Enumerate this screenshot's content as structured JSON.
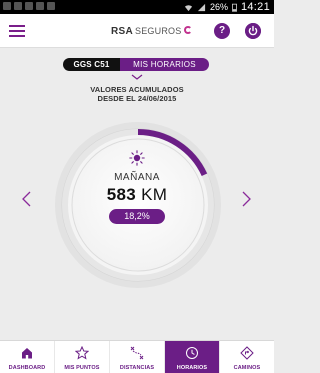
{
  "status_bar": {
    "battery": "26%",
    "time": "14:21"
  },
  "header": {
    "logo_brand": "RSA",
    "logo_text": "SEGUROS",
    "help_label": "?"
  },
  "selector": {
    "vehicle": "GGS C51",
    "tab": "MIS HORARIOS"
  },
  "summary": {
    "line1": "VALORES ACUMULADOS",
    "line2": "DESDE EL 24/06/2015"
  },
  "gauge": {
    "period": "MAÑANA",
    "distance_value": "583",
    "distance_unit": "KM",
    "percentage": "18,2%",
    "fill_fraction": 0.182,
    "period_icon": "sun-icon"
  },
  "bottom_nav": [
    {
      "label": "DASHBOARD",
      "icon": "home-icon",
      "active": false
    },
    {
      "label": "MIS PUNTOS",
      "icon": "star-icon",
      "active": false
    },
    {
      "label": "DISTANCIAS",
      "icon": "route-icon",
      "active": false
    },
    {
      "label": "HORARIOS",
      "icon": "clock-icon",
      "active": true
    },
    {
      "label": "CAMINOS",
      "icon": "road-sign-icon",
      "active": false
    }
  ],
  "colors": {
    "accent": "#6b1e86",
    "background": "#ececec"
  }
}
